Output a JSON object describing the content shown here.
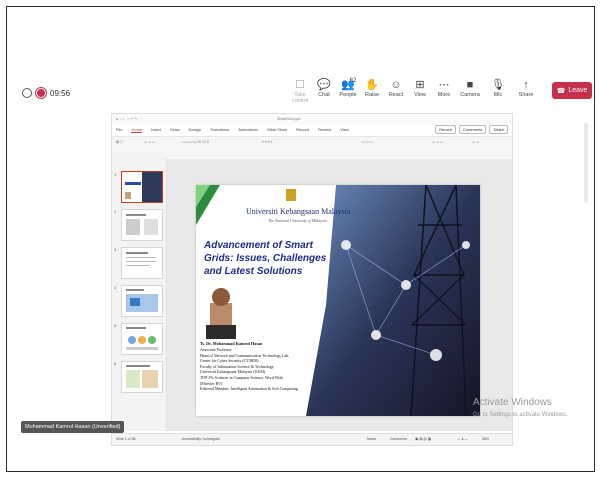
{
  "meeting": {
    "timer": "09:56",
    "controls": [
      {
        "label": "Take control",
        "icon": "take-control-icon",
        "glyph": "☐",
        "disabled": true
      },
      {
        "label": "Chat",
        "icon": "chat-icon",
        "glyph": "💬",
        "disabled": false
      },
      {
        "label": "People",
        "icon": "people-icon",
        "glyph": "👥",
        "disabled": false,
        "badge": "62"
      },
      {
        "label": "Raise",
        "icon": "raise-hand-icon",
        "glyph": "✋",
        "disabled": false
      },
      {
        "label": "React",
        "icon": "react-icon",
        "glyph": "☺",
        "disabled": false
      },
      {
        "label": "View",
        "icon": "view-icon",
        "glyph": "⊞",
        "disabled": false
      },
      {
        "label": "More",
        "icon": "more-icon",
        "glyph": "⋯",
        "disabled": false
      },
      {
        "label": "Camera",
        "icon": "camera-off-icon",
        "glyph": "■",
        "disabled": false
      },
      {
        "label": "Mic",
        "icon": "mic-off-icon",
        "glyph": "🎙",
        "disabled": false
      },
      {
        "label": "Share",
        "icon": "share-icon",
        "glyph": "↑",
        "disabled": false
      }
    ],
    "leave_label": "Leave",
    "presenter_name": "Mohammad Kamrul Hasan (Unverified)",
    "watermark_title": "Activate Windows",
    "watermark_sub": "Go to Settings to activate Windows."
  },
  "ppt": {
    "menu": [
      "File",
      "Home",
      "Insert",
      "Draw",
      "Design",
      "Transitions",
      "Animations",
      "Slide Show",
      "Record",
      "Review",
      "View"
    ],
    "active_menu": "Home",
    "record_label": "Record",
    "comments_label": "Comments",
    "share_label": "Share",
    "status_left": "Slide 1 of 38",
    "status_accessibility": "Accessibility: Investigate",
    "status_notes": "Notes",
    "status_comments": "Comments",
    "zoom": "68%"
  },
  "slide": {
    "university": "Universiti Kebangsaan Malaysia",
    "university_sub": "The National University of Malaysia",
    "title": "Advancement of Smart Grids: Issues, Challenges and Latest Solutions",
    "author_name": "Ts. Dr. Mohammad Kamrul Hasan",
    "author_lines": [
      "Associate Professor",
      "Head of Network and Communication Technology Lab,",
      "Center for Cyber Security (CYBER)",
      "Faculty of Information Science & Technology",
      "Universiti Kebangsaan Malaysia (UKM)",
      "TOP 2% Scientist in Computer Science, Word Wide",
      "(Elsevier BV)",
      "Editorial Member: Intelligent Automation & Soft Computing"
    ]
  },
  "thumbnails": [
    "1",
    "2",
    "3",
    "4",
    "5",
    "6"
  ]
}
